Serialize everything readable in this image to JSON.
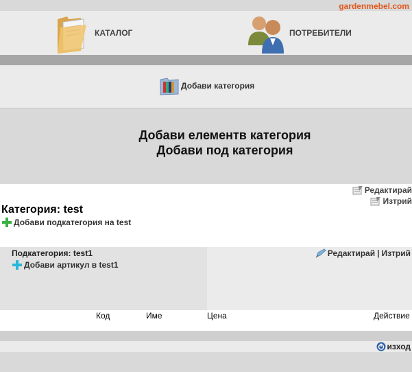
{
  "brand": "gardenmebel.com",
  "nav": {
    "catalog_label": "КАТАЛОГ",
    "users_label": "ПОТРЕБИТЕЛИ"
  },
  "toolbar": {
    "add_category_label": "Добави категория"
  },
  "headline": {
    "line1": "Добави елементв категория",
    "line2": "Добави под категория"
  },
  "category": {
    "edit_label": "Редактирай",
    "delete_label": "Изтрий",
    "title": "Категория: test",
    "add_subcategory_label": "Добави подкатегория на test"
  },
  "subcategory": {
    "title": "Подкатегория: test1",
    "add_article_label": "Добави артикул в test1",
    "edit_label": "Редактирай",
    "separator": "|",
    "delete_label": "Изтрий"
  },
  "table": {
    "columns": [
      "Код",
      "Име",
      "Цена",
      "Действие"
    ]
  },
  "footer": {
    "exit_label": "изход"
  },
  "colors": {
    "brand": "#e2581d",
    "panel": "#ebebeb",
    "dark_bar": "#a6a6a6",
    "plus_green": "#3cb043",
    "plus_cyan": "#27b7d8"
  }
}
